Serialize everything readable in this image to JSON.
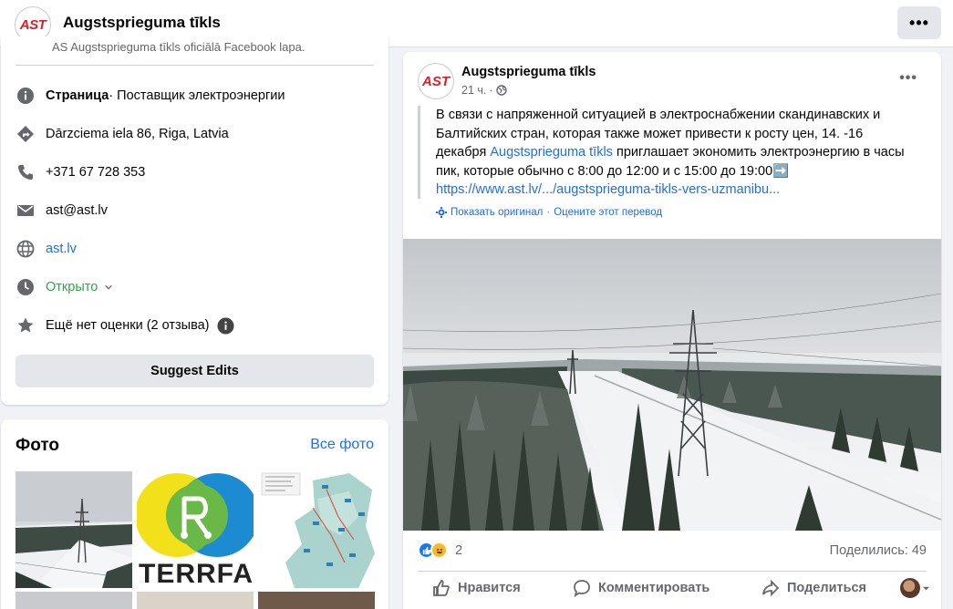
{
  "header": {
    "logo_text": "AST",
    "page_name": "Augstsprieguma tīkls",
    "more_label": "•••"
  },
  "intro": {
    "cut_text": "AS Augstsprieguma tīkls oficiālā Facebook lapa.",
    "category_bold": "Страница",
    "category_rest": " · Поставщик электроэнергии",
    "address": "Dārzciema iela 86, Riga, Latvia",
    "phone": "+371 67 728 353",
    "email": "ast@ast.lv",
    "website": "ast.lv",
    "hours": "Открыто",
    "rating": "Ещё нет оценки (2 отзыва)",
    "suggest_button": "Suggest Edits"
  },
  "photos": {
    "title": "Фото",
    "all_link": "Все фото",
    "thumb_terrfa_text": "TERRFA"
  },
  "post": {
    "logo_text": "AST",
    "author": "Augstsprieguma tīkls",
    "time": "21 ч.",
    "text_line1": "В связи с напряженной ситуацией в электроснабжении скандинавских и",
    "text_line2": "Балтийских стран, которая также может привести к росту цен, 14. -16",
    "text_line3_pre": "декабря ",
    "text_line3_link": "Augstsprieguma tīkls",
    "text_line3_post": " приглашает экономить электроэнергию в часы",
    "text_line4": "пик, которые обычно с 8:00 до 12:00 и с 15:00 до 19:00➡️",
    "url": "https://www.ast.lv/.../augstsprieguma-tikls-vers-uzmanibu...",
    "show_original": "Показать оригинал",
    "rate_translation": "Оцените этот перевод",
    "reaction_count": "2",
    "shares": "Поделились: 49",
    "like_label": "Нравится",
    "comment_label": "Комментировать",
    "share_label": "Поделиться"
  },
  "colors": {
    "brand_red": "#d6202a",
    "link_blue": "#216fdb",
    "open_green": "#31a24c"
  }
}
